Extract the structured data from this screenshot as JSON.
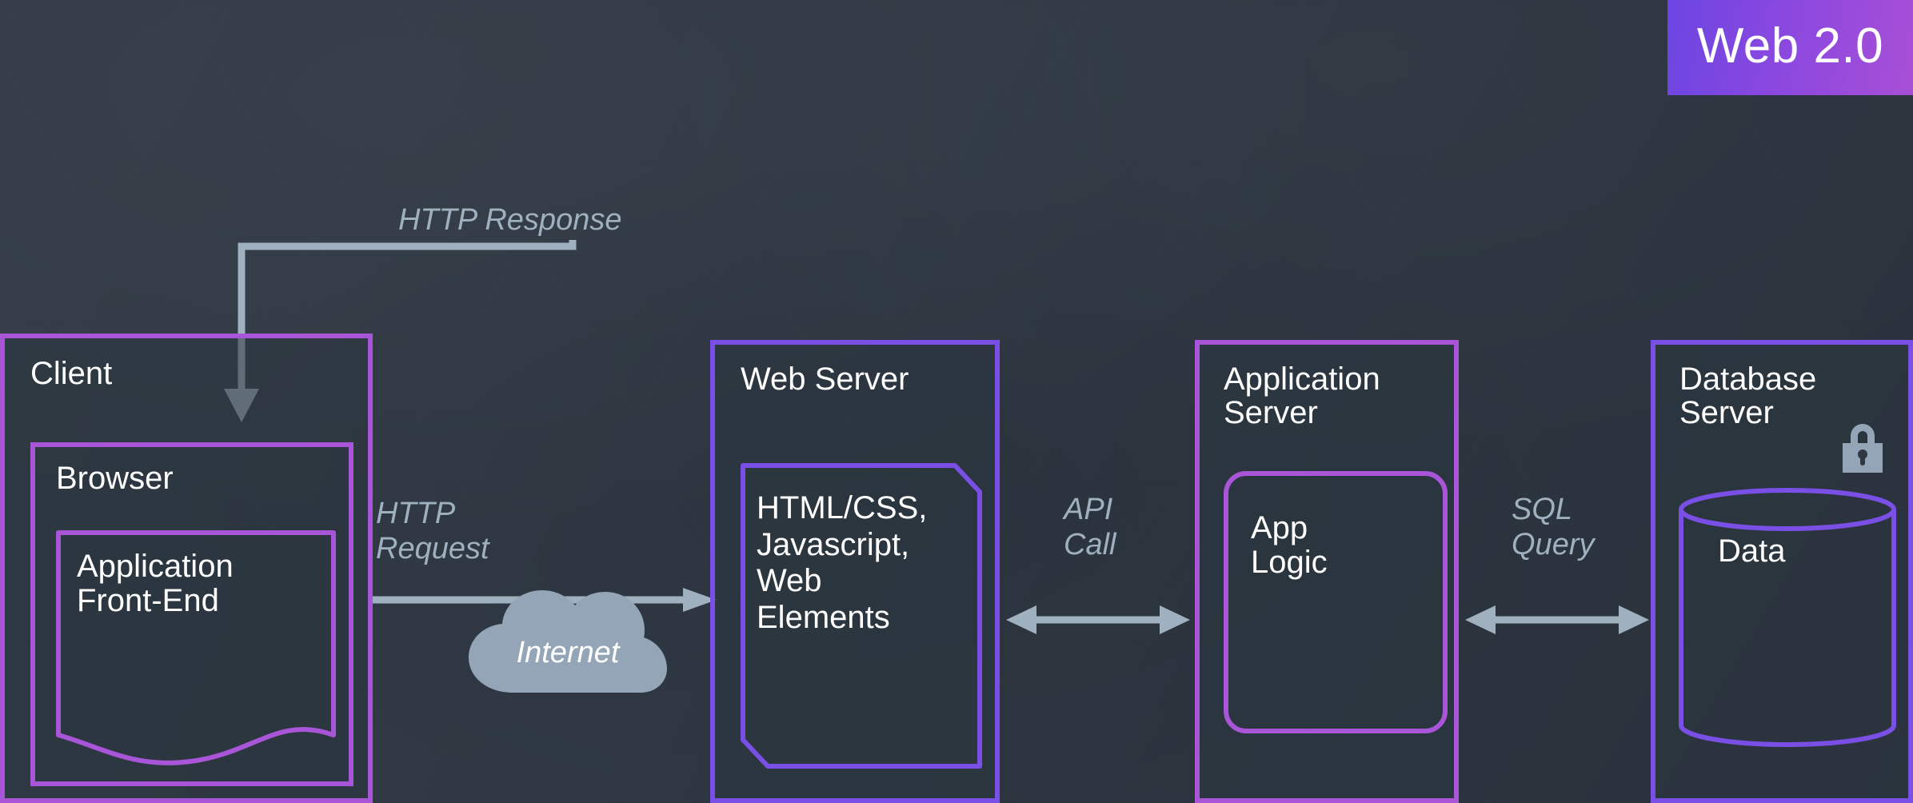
{
  "title_badge": {
    "label": "Web 2.0",
    "gradient_from": "#6c45e2",
    "gradient_to": "#a84fd6"
  },
  "colors": {
    "background": "#2e3742",
    "border_magenta": "#a855d8",
    "border_violet": "#7a4fe6",
    "connector": "#9fb0bf",
    "text": "#ffffff",
    "cloud": "#93a5b6"
  },
  "nodes": {
    "client": {
      "title": "Client",
      "browser": {
        "title": "Browser",
        "front_end": {
          "label": "Application\nFront-End",
          "shape": "document"
        }
      }
    },
    "web_server": {
      "title": "Web Server",
      "content": {
        "label": "HTML/CSS,\nJavascript,\nWeb\nElements",
        "shape": "cut-corner-box"
      }
    },
    "application_server": {
      "title": "Application\nServer",
      "logic": {
        "label": "App\nLogic",
        "shape": "rounded-box"
      }
    },
    "database_server": {
      "title": "Database\nServer",
      "lock_icon": "lock-icon",
      "data": {
        "label": "Data",
        "shape": "cylinder"
      }
    }
  },
  "connectors": {
    "http_response": {
      "label": "HTTP Response",
      "direction": "web-server-to-browser",
      "arrow": "single"
    },
    "http_request": {
      "label": "HTTP\nRequest",
      "direction": "client-to-web-server",
      "arrow": "single"
    },
    "internet": {
      "label": "Internet",
      "icon": "cloud-icon"
    },
    "api_call": {
      "label": "API\nCall",
      "direction": "bidirectional",
      "arrow": "double"
    },
    "sql_query": {
      "label": "SQL\nQuery",
      "direction": "bidirectional",
      "arrow": "double"
    }
  }
}
